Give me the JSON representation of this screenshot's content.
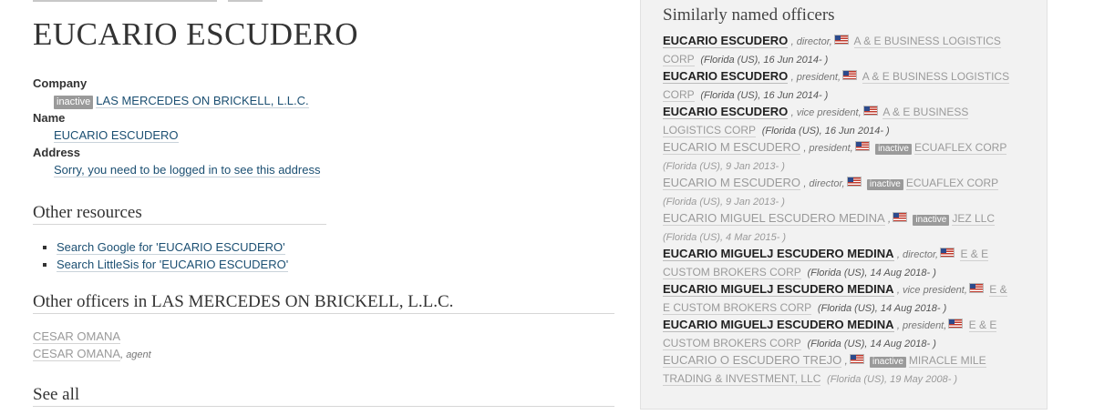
{
  "officer": {
    "name": "EUCARIO ESCUDERO",
    "company_label": "Company",
    "company_status": "inactive",
    "company_name": "LAS MERCEDES ON BRICKELL, L.L.C.",
    "name_label": "Name",
    "name_value": "EUCARIO ESCUDERO",
    "address_label": "Address",
    "address_value": "Sorry, you need to be logged in to see this address"
  },
  "other_resources": {
    "title": "Other resources",
    "links": [
      "Search Google for 'EUCARIO ESCUDERO'",
      "Search LittleSis for 'EUCARIO ESCUDERO'"
    ]
  },
  "other_officers": {
    "title": "Other officers in LAS MERCEDES ON BRICKELL, L.L.C.",
    "items": [
      {
        "name": "CESAR OMANA",
        "role": ""
      },
      {
        "name": "CESAR OMANA",
        "role": ", agent"
      }
    ]
  },
  "see_all": "See all",
  "similar": {
    "title": "Similarly named officers",
    "items": [
      {
        "name": "EUCARIO ESCUDERO",
        "role": ", director,",
        "badge": "",
        "company_1": "A & E BUSINESS LOGISTICS",
        "company_2": "CORP",
        "juris": "(Florida (US), 16 Jun 2014- )",
        "inactive": false
      },
      {
        "name": "EUCARIO ESCUDERO",
        "role": ", president,",
        "badge": "",
        "company_1": "A & E BUSINESS LOGISTICS",
        "company_2": "CORP",
        "juris": "(Florida (US), 16 Jun 2014- )",
        "inactive": false
      },
      {
        "name": "EUCARIO ESCUDERO",
        "role": ", vice president,",
        "badge": "",
        "company_1": "A & E BUSINESS",
        "company_2": "LOGISTICS CORP",
        "juris": "(Florida (US), 16 Jun 2014- )",
        "inactive": false
      },
      {
        "name": "EUCARIO M ESCUDERO",
        "role": ", president,",
        "badge": "inactive",
        "company_1": "ECUAFLEX CORP",
        "company_2": "",
        "juris": "(Florida (US), 9 Jan 2013- )",
        "inactive": true
      },
      {
        "name": "EUCARIO M ESCUDERO",
        "role": ", director,",
        "badge": "inactive",
        "company_1": "ECUAFLEX CORP",
        "company_2": "",
        "juris": "(Florida (US), 9 Jan 2013- )",
        "inactive": true
      },
      {
        "name": "EUCARIO MIGUEL ESCUDERO MEDINA",
        "role": ",",
        "badge": "inactive",
        "company_1": "JEZ LLC",
        "company_2": "",
        "juris": "(Florida (US), 4 Mar 2015- )",
        "inactive": true
      },
      {
        "name": "EUCARIO MIGUELJ ESCUDERO MEDINA",
        "role": ", director,",
        "badge": "",
        "company_1": "E & E",
        "company_2": "CUSTOM BROKERS CORP",
        "juris": "(Florida (US), 14 Aug 2018- )",
        "inactive": false
      },
      {
        "name": "EUCARIO MIGUELJ ESCUDERO MEDINA",
        "role": ", vice president,",
        "badge": "",
        "company_1": "E &",
        "company_2": "E CUSTOM BROKERS CORP",
        "juris": "(Florida (US), 14 Aug 2018- )",
        "inactive": false
      },
      {
        "name": "EUCARIO MIGUELJ ESCUDERO MEDINA",
        "role": ", president,",
        "badge": "",
        "company_1": "E & E",
        "company_2": "CUSTOM BROKERS CORP",
        "juris": "(Florida (US), 14 Aug 2018- )",
        "inactive": false
      },
      {
        "name": "EUCARIO O ESCUDERO TREJO",
        "role": ",",
        "badge": "inactive",
        "company_1": "MIRACLE MILE",
        "company_2": "TRADING & INVESTMENT, LLC",
        "juris": "(Florida (US), 19 May 2008- )",
        "inactive": true
      }
    ]
  }
}
